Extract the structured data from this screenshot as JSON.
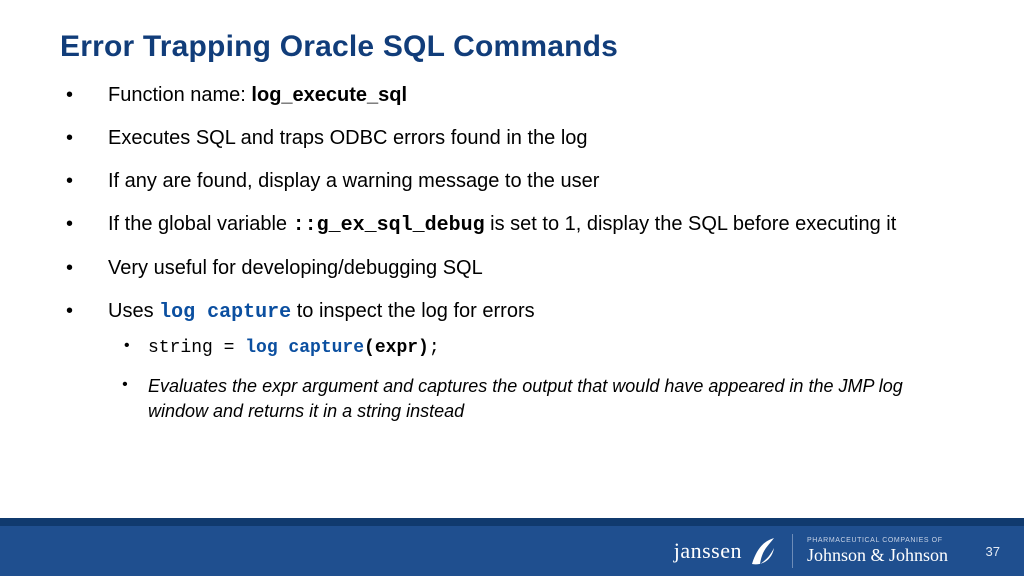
{
  "title": "Error Trapping Oracle SQL Commands",
  "bullets": {
    "b1_prefix": "Function name: ",
    "b1_code": "log_execute_sql",
    "b2": "Executes SQL and traps ODBC errors found in the log",
    "b3": "If any are found, display a warning message to the user",
    "b4_a": "If the global variable ",
    "b4_code": "::g_ex_sql_debug",
    "b4_b": " is set to 1, display the SQL before executing it",
    "b5": "Very useful for developing/debugging SQL",
    "b6_a": "Uses ",
    "b6_code": "log capture",
    "b6_b": " to inspect the log for errors"
  },
  "sub": {
    "s1_a": "string = ",
    "s1_b": "log capture",
    "s1_c": "(expr)",
    "s1_d": ";",
    "s2": "Evaluates the expr argument and captures the output that would have appeared in the JMP log window and returns it in a string instead"
  },
  "footer": {
    "brand": "janssen",
    "jnj_small": "PHARMACEUTICAL COMPANIES OF",
    "jnj_script": "Johnson & Johnson",
    "page": "37"
  }
}
